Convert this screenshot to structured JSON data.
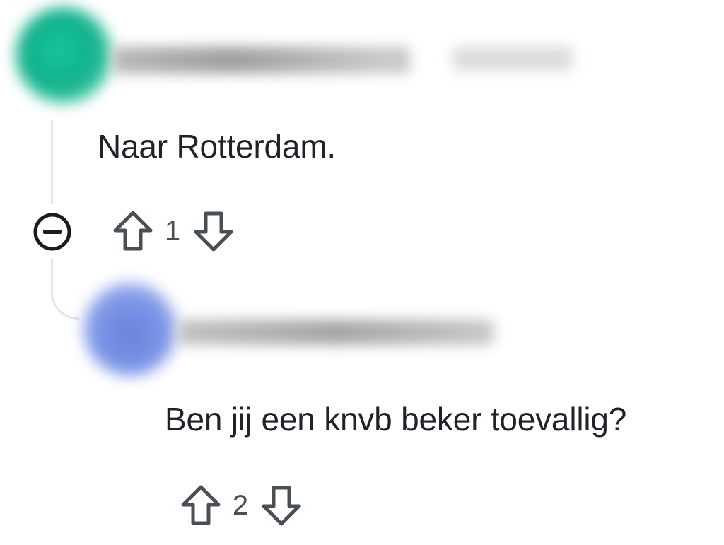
{
  "thread": {
    "parent_comment": {
      "body": "Naar Rotterdam.",
      "score": "1",
      "avatar_icon": "user-avatar-icon",
      "avatar_color": "#11b08a"
    },
    "collapse_icon": "collapse-minus-icon",
    "reply_comment": {
      "body": "Ben jij een knvb beker toevallig?",
      "score": "2",
      "avatar_icon": "user-avatar-icon",
      "avatar_color": "#6a82d8"
    }
  },
  "icons": {
    "upvote": "upvote-arrow-icon",
    "downvote": "downvote-arrow-icon"
  },
  "colors": {
    "text": "#1f2328",
    "icon": "#4a4f55",
    "thread_line": "#e5e5e5"
  }
}
